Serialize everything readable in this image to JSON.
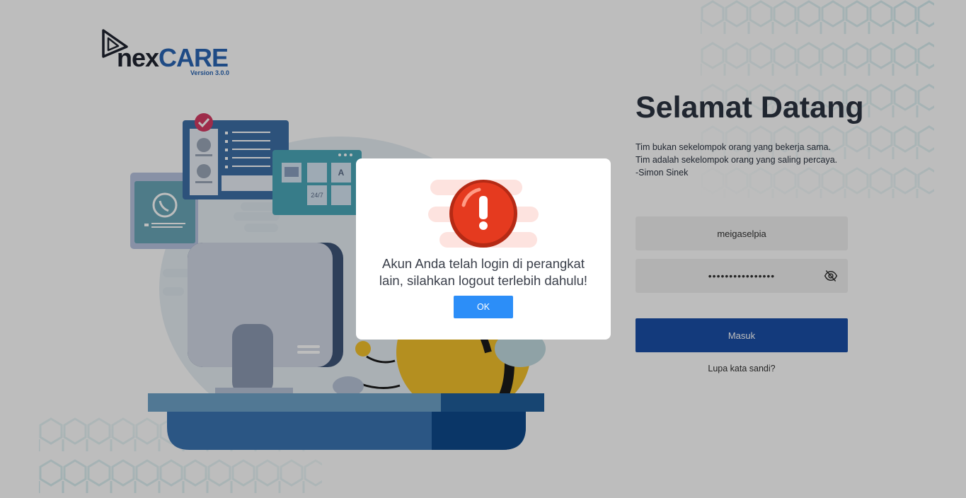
{
  "logo": {
    "brand_prefix": "nex",
    "brand_suffix": "CARE",
    "version": "Version 3.0.0"
  },
  "welcome": {
    "title": "Selamat Datang",
    "quote_lines": [
      "Tim bukan sekelompok orang yang bekerja sama.",
      "Tim adalah sekelompok orang yang saling percaya.",
      "-Simon Sinek"
    ]
  },
  "form": {
    "username_value": "meigaselpia",
    "password_value": "••••••••••••••••",
    "submit_label": "Masuk",
    "forgot_label": "Lupa kata sandi?"
  },
  "illustration": {
    "badge_text": "24/7",
    "letter_tile": "A"
  },
  "modal": {
    "icon": "exclamation-icon",
    "message": "Akun Anda telah login di perangkat lain, silahkan logout terlebih dahulu!",
    "ok_label": "OK"
  },
  "colors": {
    "brand_dark": "#1f2430",
    "brand_blue": "#2a66b4",
    "submit_button": "#1a4fa8",
    "ok_button": "#2c8ef8",
    "alert_red": "#e53a1f"
  }
}
